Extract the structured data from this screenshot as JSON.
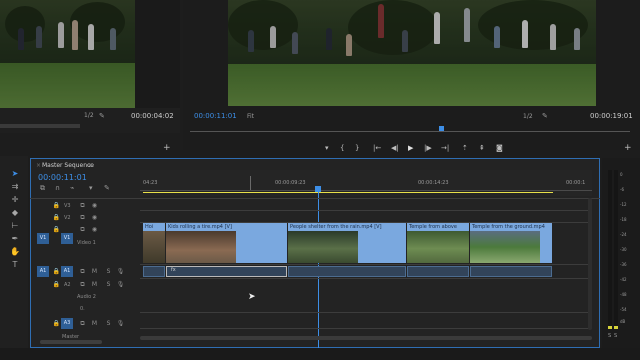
{
  "source_monitor": {
    "zoom": "1/2",
    "timecode": "00:00:04:02"
  },
  "program_monitor": {
    "current_time": "00:00:11:01",
    "zoom": "Fit",
    "ratio": "1/2",
    "duration": "00:00:19:01",
    "playhead_fraction": 0.57
  },
  "sequence": {
    "title": "Master Sequence",
    "menu_icon": "≡",
    "close_icon": "×",
    "timecode": "00:00:11:01",
    "ruler_labels": [
      "04:23",
      "00:00:09:23",
      "00:00:14:23",
      "00:00:1"
    ],
    "tracks": {
      "video": [
        {
          "name": "V3",
          "source_patch": ""
        },
        {
          "name": "V2",
          "source_patch": ""
        },
        {
          "name": "V1",
          "source_patch": "V1",
          "label": "Video 1"
        }
      ],
      "audio": [
        {
          "name": "A1",
          "source_patch": "A1",
          "buttons": [
            "M",
            "S"
          ]
        },
        {
          "name": "A2",
          "source_patch": "",
          "buttons": [
            "M",
            "S"
          ],
          "label": "Audio 2"
        },
        {
          "name": "A3",
          "source_patch": "A3",
          "buttons": [
            "M",
            "S"
          ]
        }
      ],
      "master_label": "Master",
      "master_value": "0.0"
    },
    "clips": [
      {
        "title": "Hoi",
        "type": "partial"
      },
      {
        "title": "Kids rolling a tire.mp4 [V]"
      },
      {
        "title": "People shelter from the rain.mp4 [V]"
      },
      {
        "title": "Temple from above"
      },
      {
        "title": "Temple from the ground.mp4"
      }
    ],
    "audio_clip_marker": "fx"
  },
  "transport": {
    "buttons": [
      "{",
      "}",
      "|←",
      "◀|",
      "▶",
      "|▶",
      "→|"
    ]
  },
  "meter": {
    "labels": [
      "S",
      "S"
    ],
    "scale": [
      "0",
      "-6",
      "-12",
      "-18",
      "-24",
      "-30",
      "-36",
      "-42",
      "-48",
      "-54",
      "dB"
    ]
  },
  "colors": {
    "accent_blue": "#3d8ee6",
    "clip_blue": "#7aa8df",
    "work_area_yellow": "#e8e04a",
    "panel_bg": "#232323"
  }
}
